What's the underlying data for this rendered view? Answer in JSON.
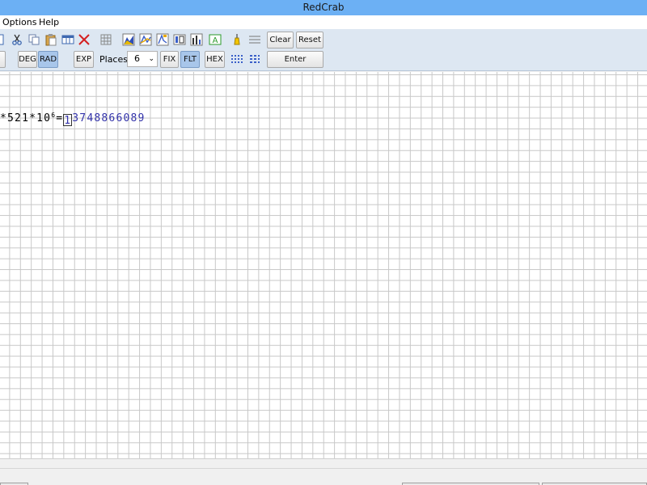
{
  "window": {
    "title": "RedCrab"
  },
  "menu": {
    "items": [
      "Options",
      "Help"
    ]
  },
  "toolbar": {
    "clear_label": "Clear",
    "reset_label": "Reset",
    "deg_label": "DEG",
    "rad_label": "RAD",
    "exp_label": "EXP",
    "places_label": "Places",
    "places_value": "6",
    "fix_label": "FIX",
    "flt_label": "FLT",
    "hex_label": "HEX",
    "enter_label": "Enter",
    "active_angle_mode": "RAD",
    "active_number_mode": "FLT"
  },
  "worksheet": {
    "expression": "*521*10",
    "exponent": "6",
    "equals": "=",
    "result_first": "1",
    "result_rest": "3748866089"
  },
  "colors": {
    "titlebar": "#6cb0f4",
    "result_text": "#3333aa",
    "active_button": "#a8c6ea"
  }
}
